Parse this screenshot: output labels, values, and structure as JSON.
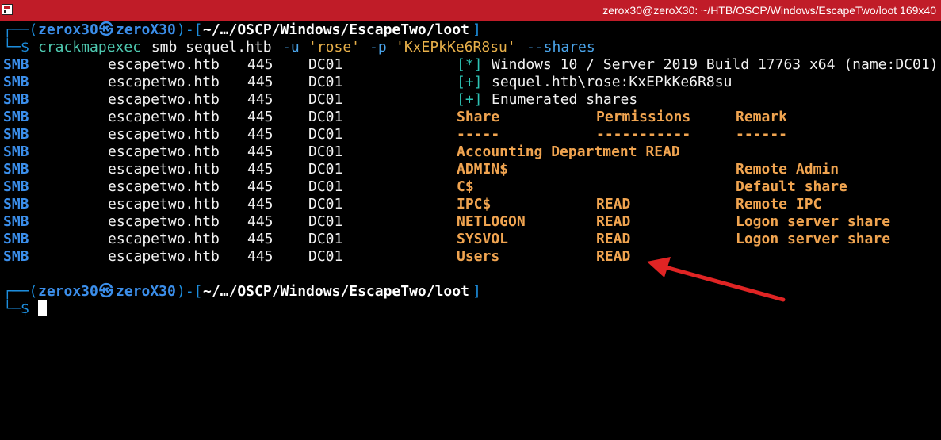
{
  "window": {
    "title": "zerox30@zeroX30: ~/HTB/OSCP/Windows/EscapeTwo/loot 169x40",
    "accent": "#c01c28"
  },
  "prompt": {
    "open": "┌──(",
    "user": "zerox30",
    "at_icon": "㉿",
    "host": "zeroX30",
    "mid": ")-[",
    "path": "~/…/OSCP/Windows/EscapeTwo/loot",
    "close": "]",
    "line2": "└─",
    "dollar": "$"
  },
  "command": {
    "bin": "crackmapexec",
    "args1": " smb sequel.htb ",
    "flag_u": "-u",
    "user_val": "'rose'",
    "flag_p": "-p",
    "pass_val": "'KxEPkKe6R8su'",
    "flag_shares": "--shares"
  },
  "rows": [
    {
      "proto": "SMB",
      "host": "escapetwo.htb",
      "port": "445",
      "name": "DC01",
      "tag": "[*]",
      "msg": "Windows 10 / Server 2019 Build 17763 x64 (name:DC01)",
      "share": "",
      "perm": "",
      "remark": ""
    },
    {
      "proto": "SMB",
      "host": "escapetwo.htb",
      "port": "445",
      "name": "DC01",
      "tag": "[+]",
      "msg": "sequel.htb\\rose:KxEPkKe6R8su",
      "share": "",
      "perm": "",
      "remark": ""
    },
    {
      "proto": "SMB",
      "host": "escapetwo.htb",
      "port": "445",
      "name": "DC01",
      "tag": "[+]",
      "msg": "Enumerated shares",
      "share": "",
      "perm": "",
      "remark": ""
    },
    {
      "proto": "SMB",
      "host": "escapetwo.htb",
      "port": "445",
      "name": "DC01",
      "tag": "",
      "msg": "",
      "share": "Share",
      "perm": "Permissions",
      "remark": "Remark"
    },
    {
      "proto": "SMB",
      "host": "escapetwo.htb",
      "port": "445",
      "name": "DC01",
      "tag": "",
      "msg": "",
      "share": "-----",
      "perm": "-----------",
      "remark": "------"
    },
    {
      "proto": "SMB",
      "host": "escapetwo.htb",
      "port": "445",
      "name": "DC01",
      "tag": "",
      "msg": "",
      "share": "Accounting Department READ",
      "perm": "",
      "remark": ""
    },
    {
      "proto": "SMB",
      "host": "escapetwo.htb",
      "port": "445",
      "name": "DC01",
      "tag": "",
      "msg": "",
      "share": "ADMIN$",
      "perm": "",
      "remark": "Remote Admin"
    },
    {
      "proto": "SMB",
      "host": "escapetwo.htb",
      "port": "445",
      "name": "DC01",
      "tag": "",
      "msg": "",
      "share": "C$",
      "perm": "",
      "remark": "Default share"
    },
    {
      "proto": "SMB",
      "host": "escapetwo.htb",
      "port": "445",
      "name": "DC01",
      "tag": "",
      "msg": "",
      "share": "IPC$",
      "perm": "READ",
      "remark": "Remote IPC"
    },
    {
      "proto": "SMB",
      "host": "escapetwo.htb",
      "port": "445",
      "name": "DC01",
      "tag": "",
      "msg": "",
      "share": "NETLOGON",
      "perm": "READ",
      "remark": "Logon server share"
    },
    {
      "proto": "SMB",
      "host": "escapetwo.htb",
      "port": "445",
      "name": "DC01",
      "tag": "",
      "msg": "",
      "share": "SYSVOL",
      "perm": "READ",
      "remark": "Logon server share"
    },
    {
      "proto": "SMB",
      "host": "escapetwo.htb",
      "port": "445",
      "name": "DC01",
      "tag": "",
      "msg": "",
      "share": "Users",
      "perm": "READ",
      "remark": ""
    }
  ],
  "annotation": {
    "color": "#e02424",
    "icon": "red-arrow"
  }
}
